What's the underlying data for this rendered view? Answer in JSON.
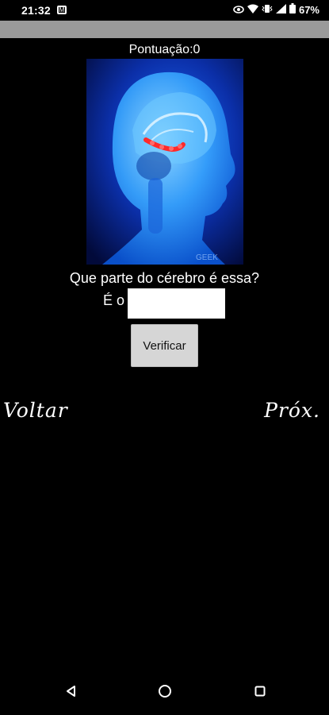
{
  "status_bar": {
    "time": "21:32",
    "battery": "67%",
    "icons": [
      "gmail-icon",
      "eye-icon",
      "wifi-icon",
      "vibrate-icon",
      "signal-icon",
      "battery-icon"
    ]
  },
  "quiz": {
    "score_label": "Pontuação:0",
    "image_watermark": "GEEK",
    "question": "Que parte do cérebro é essa?",
    "answer_prefix": "É o",
    "answer_value": "",
    "verify_label": "Verificar",
    "back_label": "Voltar",
    "next_label": "Próx."
  },
  "nav_bar": {
    "buttons": [
      "back-triangle-icon",
      "home-circle-icon",
      "recents-square-icon"
    ]
  },
  "colors": {
    "background": "#000000",
    "app_bar": "#9a9a9a",
    "button": "#d6d6d6",
    "brain_highlight": "#ff2a2a"
  }
}
